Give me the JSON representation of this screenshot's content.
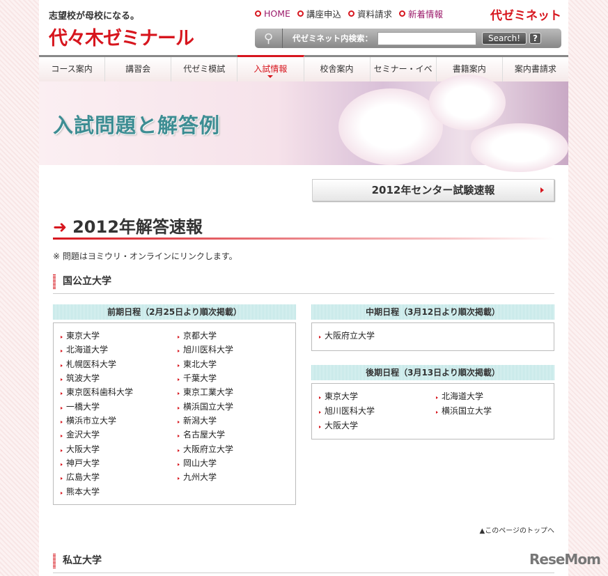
{
  "header": {
    "tagline": "志望校が母校になる。",
    "logo": "代々木ゼミナール",
    "net_logo": "代ゼミネット",
    "links": [
      "HOME",
      "講座申込",
      "資料請求",
      "新着情報"
    ],
    "search": {
      "label": "代ゼミネット内検索：",
      "value": "",
      "button": "Search!",
      "help": "?"
    }
  },
  "nav": [
    "コース案内",
    "講習会",
    "代ゼミ模試",
    "入試情報",
    "校舎案内",
    "セミナー・イベント",
    "書籍案内",
    "案内書請求"
  ],
  "banner": {
    "title": "入試問題と解答例"
  },
  "center_button": "2012年センター試験速報",
  "heading": "2012年解答速報",
  "note": "※ 問題はヨミウリ・オンラインにリンクします。",
  "section_national": "国公立大学",
  "early": {
    "title": "前期日程（2月25日より順次掲載）",
    "items": [
      "東京大学",
      "京都大学",
      "北海道大学",
      "旭川医科大学",
      "札幌医科大学",
      "東北大学",
      "筑波大学",
      "千葉大学",
      "東京医科歯科大学",
      "東京工業大学",
      "一橋大学",
      "横浜国立大学",
      "横浜市立大学",
      "新潟大学",
      "金沢大学",
      "名古屋大学",
      "大阪大学",
      "大阪府立大学",
      "神戸大学",
      "岡山大学",
      "広島大学",
      "九州大学",
      "熊本大学"
    ]
  },
  "middle": {
    "title": "中期日程（3月12日より順次掲載）",
    "items": [
      "大阪府立大学"
    ]
  },
  "late": {
    "title": "後期日程（3月13日より順次掲載）",
    "items": [
      "東京大学",
      "北海道大学",
      "旭川医科大学",
      "横浜国立大学",
      "大阪大学"
    ]
  },
  "back_to_top": "▲このページのトップへ",
  "section_private": "私立大学",
  "watermark": "ReseMom"
}
